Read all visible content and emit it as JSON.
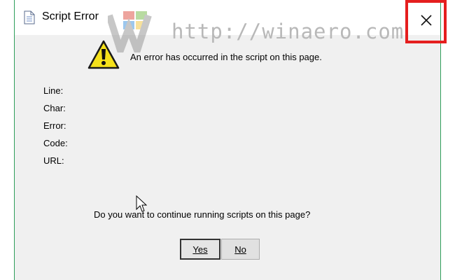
{
  "window": {
    "title": "Script Error",
    "close_glyph": "✕"
  },
  "watermark": {
    "text": "http://winaero.com"
  },
  "message": "An error has occurred in the script on this page.",
  "fields": [
    {
      "label": "Line:",
      "value": ""
    },
    {
      "label": "Char:",
      "value": ""
    },
    {
      "label": "Error:",
      "value": ""
    },
    {
      "label": "Code:",
      "value": ""
    },
    {
      "label": "URL:",
      "value": ""
    }
  ],
  "question": "Do you want to continue running scripts on this page?",
  "buttons": {
    "yes": "Yes",
    "no": "No"
  },
  "icons": {
    "title": "document-icon",
    "warning": "warning-icon",
    "close": "close-icon",
    "cursor": "mouse-cursor-icon"
  },
  "colors": {
    "window_border": "#2e9e5a",
    "close_highlight": "#e51e1e",
    "warning_fill": "#f5e11b"
  }
}
